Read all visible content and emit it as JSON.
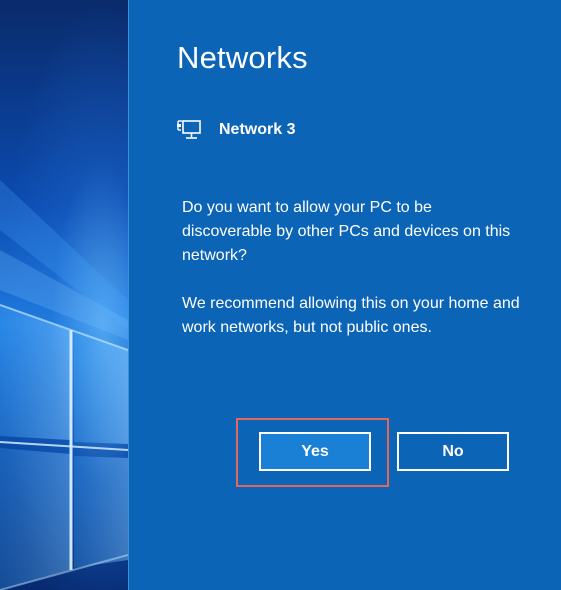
{
  "flyout": {
    "title": "Networks",
    "network": {
      "icon": "wired-network-icon",
      "name": "Network 3"
    },
    "prompt": "Do you want to allow your PC to be discoverable by other PCs and devices on this network?",
    "recommendation": "We recommend allowing this on your home and work networks, but not public ones.",
    "buttons": {
      "yes_label": "Yes",
      "no_label": "No"
    }
  },
  "colors": {
    "panel_background": "#0b64b6",
    "selected_button": "#1a80d6",
    "highlight_outline": "#e2685c",
    "text": "#ffffff"
  }
}
